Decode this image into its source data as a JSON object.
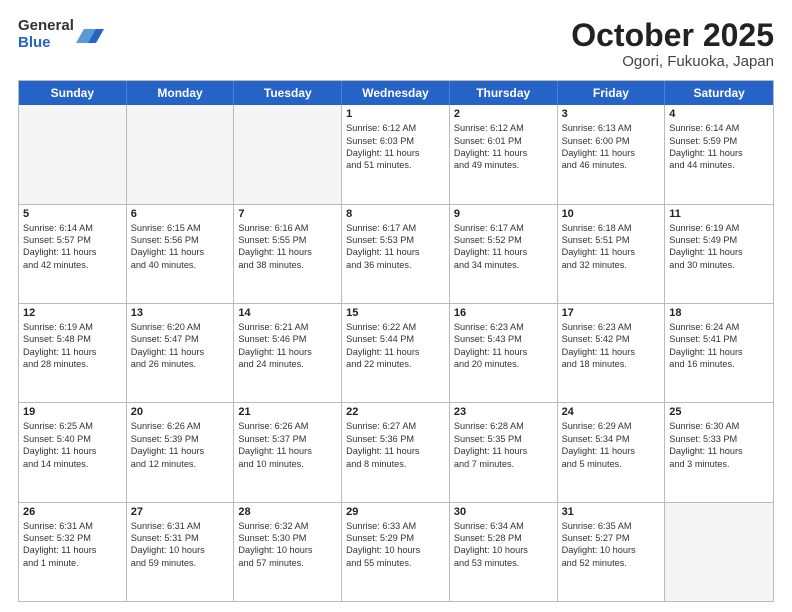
{
  "logo": {
    "general": "General",
    "blue": "Blue"
  },
  "header": {
    "month": "October 2025",
    "location": "Ogori, Fukuoka, Japan"
  },
  "weekdays": [
    "Sunday",
    "Monday",
    "Tuesday",
    "Wednesday",
    "Thursday",
    "Friday",
    "Saturday"
  ],
  "rows": [
    [
      {
        "day": "",
        "lines": []
      },
      {
        "day": "",
        "lines": []
      },
      {
        "day": "",
        "lines": []
      },
      {
        "day": "1",
        "lines": [
          "Sunrise: 6:12 AM",
          "Sunset: 6:03 PM",
          "Daylight: 11 hours",
          "and 51 minutes."
        ]
      },
      {
        "day": "2",
        "lines": [
          "Sunrise: 6:12 AM",
          "Sunset: 6:01 PM",
          "Daylight: 11 hours",
          "and 49 minutes."
        ]
      },
      {
        "day": "3",
        "lines": [
          "Sunrise: 6:13 AM",
          "Sunset: 6:00 PM",
          "Daylight: 11 hours",
          "and 46 minutes."
        ]
      },
      {
        "day": "4",
        "lines": [
          "Sunrise: 6:14 AM",
          "Sunset: 5:59 PM",
          "Daylight: 11 hours",
          "and 44 minutes."
        ]
      }
    ],
    [
      {
        "day": "5",
        "lines": [
          "Sunrise: 6:14 AM",
          "Sunset: 5:57 PM",
          "Daylight: 11 hours",
          "and 42 minutes."
        ]
      },
      {
        "day": "6",
        "lines": [
          "Sunrise: 6:15 AM",
          "Sunset: 5:56 PM",
          "Daylight: 11 hours",
          "and 40 minutes."
        ]
      },
      {
        "day": "7",
        "lines": [
          "Sunrise: 6:16 AM",
          "Sunset: 5:55 PM",
          "Daylight: 11 hours",
          "and 38 minutes."
        ]
      },
      {
        "day": "8",
        "lines": [
          "Sunrise: 6:17 AM",
          "Sunset: 5:53 PM",
          "Daylight: 11 hours",
          "and 36 minutes."
        ]
      },
      {
        "day": "9",
        "lines": [
          "Sunrise: 6:17 AM",
          "Sunset: 5:52 PM",
          "Daylight: 11 hours",
          "and 34 minutes."
        ]
      },
      {
        "day": "10",
        "lines": [
          "Sunrise: 6:18 AM",
          "Sunset: 5:51 PM",
          "Daylight: 11 hours",
          "and 32 minutes."
        ]
      },
      {
        "day": "11",
        "lines": [
          "Sunrise: 6:19 AM",
          "Sunset: 5:49 PM",
          "Daylight: 11 hours",
          "and 30 minutes."
        ]
      }
    ],
    [
      {
        "day": "12",
        "lines": [
          "Sunrise: 6:19 AM",
          "Sunset: 5:48 PM",
          "Daylight: 11 hours",
          "and 28 minutes."
        ]
      },
      {
        "day": "13",
        "lines": [
          "Sunrise: 6:20 AM",
          "Sunset: 5:47 PM",
          "Daylight: 11 hours",
          "and 26 minutes."
        ]
      },
      {
        "day": "14",
        "lines": [
          "Sunrise: 6:21 AM",
          "Sunset: 5:46 PM",
          "Daylight: 11 hours",
          "and 24 minutes."
        ]
      },
      {
        "day": "15",
        "lines": [
          "Sunrise: 6:22 AM",
          "Sunset: 5:44 PM",
          "Daylight: 11 hours",
          "and 22 minutes."
        ]
      },
      {
        "day": "16",
        "lines": [
          "Sunrise: 6:23 AM",
          "Sunset: 5:43 PM",
          "Daylight: 11 hours",
          "and 20 minutes."
        ]
      },
      {
        "day": "17",
        "lines": [
          "Sunrise: 6:23 AM",
          "Sunset: 5:42 PM",
          "Daylight: 11 hours",
          "and 18 minutes."
        ]
      },
      {
        "day": "18",
        "lines": [
          "Sunrise: 6:24 AM",
          "Sunset: 5:41 PM",
          "Daylight: 11 hours",
          "and 16 minutes."
        ]
      }
    ],
    [
      {
        "day": "19",
        "lines": [
          "Sunrise: 6:25 AM",
          "Sunset: 5:40 PM",
          "Daylight: 11 hours",
          "and 14 minutes."
        ]
      },
      {
        "day": "20",
        "lines": [
          "Sunrise: 6:26 AM",
          "Sunset: 5:39 PM",
          "Daylight: 11 hours",
          "and 12 minutes."
        ]
      },
      {
        "day": "21",
        "lines": [
          "Sunrise: 6:26 AM",
          "Sunset: 5:37 PM",
          "Daylight: 11 hours",
          "and 10 minutes."
        ]
      },
      {
        "day": "22",
        "lines": [
          "Sunrise: 6:27 AM",
          "Sunset: 5:36 PM",
          "Daylight: 11 hours",
          "and 8 minutes."
        ]
      },
      {
        "day": "23",
        "lines": [
          "Sunrise: 6:28 AM",
          "Sunset: 5:35 PM",
          "Daylight: 11 hours",
          "and 7 minutes."
        ]
      },
      {
        "day": "24",
        "lines": [
          "Sunrise: 6:29 AM",
          "Sunset: 5:34 PM",
          "Daylight: 11 hours",
          "and 5 minutes."
        ]
      },
      {
        "day": "25",
        "lines": [
          "Sunrise: 6:30 AM",
          "Sunset: 5:33 PM",
          "Daylight: 11 hours",
          "and 3 minutes."
        ]
      }
    ],
    [
      {
        "day": "26",
        "lines": [
          "Sunrise: 6:31 AM",
          "Sunset: 5:32 PM",
          "Daylight: 11 hours",
          "and 1 minute."
        ]
      },
      {
        "day": "27",
        "lines": [
          "Sunrise: 6:31 AM",
          "Sunset: 5:31 PM",
          "Daylight: 10 hours",
          "and 59 minutes."
        ]
      },
      {
        "day": "28",
        "lines": [
          "Sunrise: 6:32 AM",
          "Sunset: 5:30 PM",
          "Daylight: 10 hours",
          "and 57 minutes."
        ]
      },
      {
        "day": "29",
        "lines": [
          "Sunrise: 6:33 AM",
          "Sunset: 5:29 PM",
          "Daylight: 10 hours",
          "and 55 minutes."
        ]
      },
      {
        "day": "30",
        "lines": [
          "Sunrise: 6:34 AM",
          "Sunset: 5:28 PM",
          "Daylight: 10 hours",
          "and 53 minutes."
        ]
      },
      {
        "day": "31",
        "lines": [
          "Sunrise: 6:35 AM",
          "Sunset: 5:27 PM",
          "Daylight: 10 hours",
          "and 52 minutes."
        ]
      },
      {
        "day": "",
        "lines": []
      }
    ]
  ]
}
